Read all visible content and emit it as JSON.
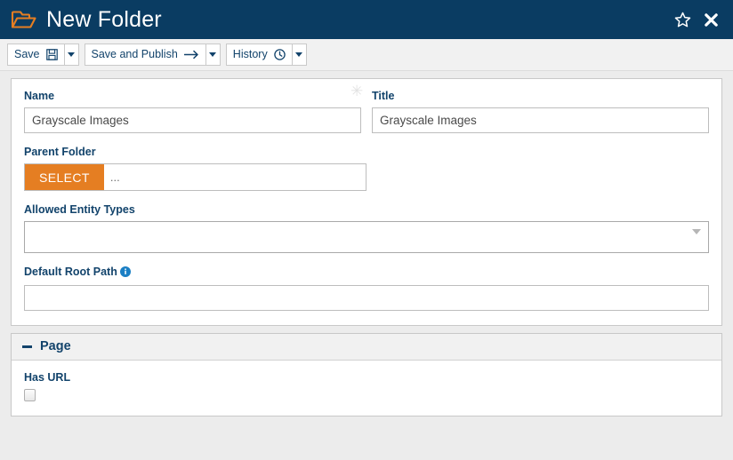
{
  "header": {
    "icon": "open-folder-icon",
    "title": "New Folder",
    "favorite_icon": "star-icon",
    "close_icon": "close-icon",
    "background_color": "#0a3c62",
    "icon_color": "#e57e22"
  },
  "toolbar": {
    "buttons": [
      {
        "label": "Save",
        "icon": "save-disk-icon",
        "caret_icon": "chevron-down-icon"
      },
      {
        "label": "Save and Publish",
        "icon": "arrow-right-icon",
        "caret_icon": "chevron-down-icon"
      },
      {
        "label": "History",
        "icon": "clock-icon",
        "caret_icon": "chevron-down-icon"
      }
    ]
  },
  "form": {
    "required_marker": "✳",
    "name": {
      "label": "Name",
      "value": "Grayscale Images",
      "placeholder": ""
    },
    "title": {
      "label": "Title",
      "value": "Grayscale Images",
      "placeholder": ""
    },
    "parent_folder": {
      "label": "Parent Folder",
      "button_label": "SELECT",
      "value": "...",
      "button_color": "#e57e22"
    },
    "allowed_entity_types": {
      "label": "Allowed Entity Types",
      "value": "",
      "caret_icon": "chevron-down-icon"
    },
    "default_root_path": {
      "label": "Default Root Path",
      "info_icon": "info-icon",
      "value": "",
      "placeholder": ""
    }
  },
  "page_section": {
    "collapse_icon": "minus-icon",
    "title": "Page",
    "has_url": {
      "label": "Has URL",
      "checked": false
    }
  }
}
